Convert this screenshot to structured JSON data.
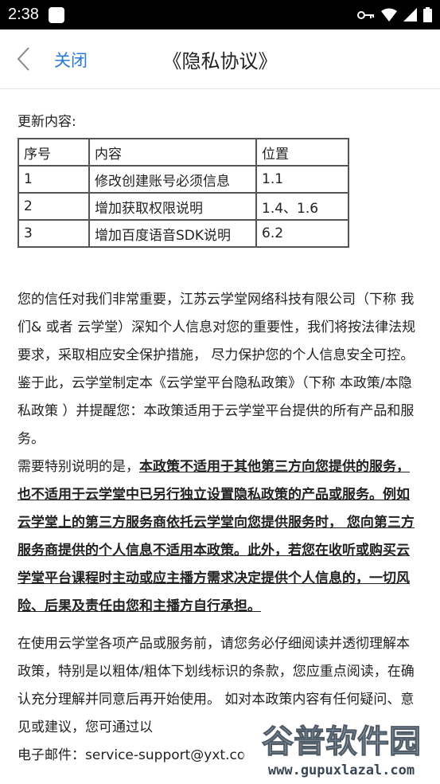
{
  "status_bar": {
    "time": "2:38"
  },
  "header": {
    "back_icon": "chevron-left-icon",
    "close_label": "关闭",
    "title": "《隐私协议》"
  },
  "update": {
    "heading": "更新内容:",
    "columns": [
      "序号",
      "内容",
      "位置"
    ],
    "rows": [
      [
        "1",
        "修改创建账号必须信息",
        "1.1"
      ],
      [
        "2",
        "增加获取权限说明",
        "1.4、1.6"
      ],
      [
        "3",
        "增加百度语音SDK说明",
        "6.2"
      ]
    ]
  },
  "body": {
    "p1": "您的信任对我们非常重要，江苏云学堂网络科技有限公司（下称 我们& 或者 云学堂）深知个人信息对您的重要性，我们将按法律法规要求，采取相应安全保护措施， 尽力保护您的个人信息安全可控。鉴于此，云学堂制定本《云学堂平台隐私政策》（下称 本政策/本隐私政策 ）并提醒您：本政策适用于云学堂平台提供的所有产品和服务。",
    "p2_lead": "需要特别说明的是，",
    "p2_emphasis": "本政策不适用于其他第三方向您提供的服务，也不适用于云学堂中已另行独立设置隐私政策的产品或服务。例如云学堂上的第三方服务商依托云学堂向您提供服务时， 您向第三方服务商提供的个人信息不适用本政策。此外，若您在收听或购买云学堂平台课程时主动或应主播方需求决定提供个人信息的，一切风险、后果及责任由您和主播方自行承担。",
    "p3_line1": "在使用云学堂各项产品或服务前，请您务必仔细阅读并透彻理解本政策，特别是以粗体/粗体下划线标识的条款，您应重点阅读，在确认充分理解并同意后再开始使用。 如对本政策内容有任何疑问、意见或建议，您可通过以",
    "p3_line2_partial": "电子邮件：service-support@yxt.co"
  },
  "watermark": {
    "brand": "谷普软件园",
    "url": "www.gupuxlazal.com"
  }
}
